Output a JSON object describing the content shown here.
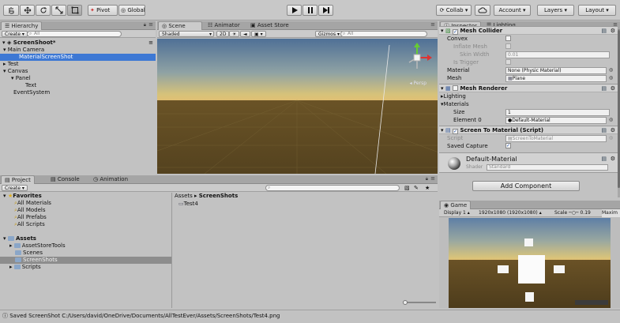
{
  "toolbar": {
    "pivot": "Pivot",
    "global": "Global",
    "collab": "Collab",
    "account": "Account",
    "layers": "Layers",
    "layout": "Layout"
  },
  "hierarchy": {
    "tab": "Hierarchy",
    "create": "Create",
    "search_placeholder": "All",
    "scene_name": "ScreenShoot*",
    "items": [
      "Main Camera",
      "MaterialScreenShot",
      "Test",
      "Canvas",
      "Panel",
      "Text",
      "EventSystem"
    ]
  },
  "scene": {
    "tabs": [
      "Scene",
      "Animator",
      "Asset Store"
    ],
    "shaded": "Shaded",
    "mode_2d": "2D",
    "gizmos": "Gizmos",
    "search_placeholder": "All",
    "persp": "Persp"
  },
  "inspector": {
    "tabs": [
      "Inspector",
      "Lighting"
    ],
    "mesh_collider": {
      "title": "Mesh Collider",
      "convex": "Convex",
      "inflate": "Inflate Mesh",
      "skin_width_label": "Skin Width",
      "skin_width": "0.01",
      "is_trigger": "Is Trigger",
      "material_label": "Material",
      "material": "None (Physic Material)",
      "mesh_label": "Mesh",
      "mesh": "Plane"
    },
    "mesh_renderer": {
      "title": "Mesh Renderer",
      "lighting": "Lighting",
      "materials": "Materials",
      "size_label": "Size",
      "size": "1",
      "element0_label": "Element 0",
      "element0": "Default-Material"
    },
    "screen_to_material": {
      "title": "Screen To Material (Script)",
      "script_label": "Script",
      "script": "ScreenToMaterial",
      "saved_capture": "Saved Capture"
    },
    "material": {
      "name": "Default-Material",
      "shader_label": "Shader",
      "shader": "Standard"
    },
    "add_component": "Add Component"
  },
  "project": {
    "tabs": [
      "Project",
      "Console",
      "Animation"
    ],
    "create": "Create",
    "favorites": "Favorites",
    "favorite_items": [
      "All Materials",
      "All Models",
      "All Prefabs",
      "All Scripts"
    ],
    "assets": "Assets",
    "asset_folders": [
      "AssetStoreTools",
      "Scenes",
      "ScreenShots",
      "Scripts"
    ],
    "breadcrumb_root": "Assets",
    "breadcrumb_leaf": "ScreenShots",
    "files": [
      "Test4"
    ]
  },
  "game": {
    "tab": "Game",
    "display": "Display 1",
    "resolution": "1920x1080 (1920x1080)",
    "scale_label": "Scale",
    "scale_value": "0.19",
    "maximize": "Maxim"
  },
  "status": {
    "message": "Saved ScreenShot C:/Users/david/OneDrive/Documents/AllTestEver/Assets/ScreenShots/Test4.png"
  },
  "colors": {
    "selection": "#3d78d4",
    "sky_top": "#5e7fa6",
    "horizon": "#d9c37a",
    "ground": "#5a4724"
  }
}
